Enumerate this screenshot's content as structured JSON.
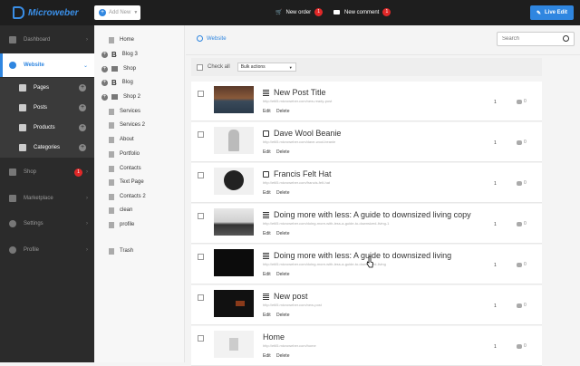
{
  "topbar": {
    "logo_text": "Microweber",
    "add_new": "Add New",
    "new_order": "New order",
    "new_order_count": "1",
    "new_comment": "New comment",
    "new_comment_count": "1",
    "live_edit": "Live Edit"
  },
  "sidebar": {
    "dashboard": "Dashboard",
    "website": "Website",
    "pages": "Pages",
    "posts": "Posts",
    "products": "Products",
    "categories": "Categories",
    "shop": "Shop",
    "shop_badge": "1",
    "marketplace": "Marketplace",
    "settings": "Settings",
    "profile": "Profile"
  },
  "tree": {
    "items": [
      "Home",
      "Blog 3",
      "Shop",
      "Blog",
      "Shop 2",
      "Services",
      "Services 2",
      "About",
      "Portfolio",
      "Contacts",
      "Text Page",
      "Contacts 2",
      "clean",
      "profile"
    ],
    "trash": "Trash"
  },
  "main": {
    "breadcrumb": "Website",
    "search_placeholder": "Search",
    "check_all": "Check all",
    "bulk_actions": "Bulk actions",
    "edit_label": "Edit",
    "delete_label": "Delete"
  },
  "rows": [
    {
      "title": "New Post Title",
      "url": "http://etil5.microweber.com/new-ready-post",
      "count": "1",
      "comments": "0",
      "type": "post"
    },
    {
      "title": "Dave Wool Beanie",
      "url": "http://etil5.microweber.com/dave-wool-beanie",
      "count": "1",
      "comments": "0",
      "type": "product"
    },
    {
      "title": "Francis Felt Hat",
      "url": "http://etil5.microweber.com/francis-felt-hat",
      "count": "1",
      "comments": "0",
      "type": "product"
    },
    {
      "title": "Doing more with less: A guide to downsized living copy",
      "url": "http://etil5.microweber.com/doing-more-with-less-a-guide-to-downsized-living-1",
      "count": "1",
      "comments": "0",
      "type": "post"
    },
    {
      "title": "Doing more with less: A guide to downsized living",
      "url": "http://etil5.microweber.com/doing-more-with-less-a-guide-to-downsized-living",
      "count": "1",
      "comments": "0",
      "type": "post"
    },
    {
      "title": "New post",
      "url": "http://etil5.microweber.com/new-post",
      "count": "1",
      "comments": "0",
      "type": "post"
    },
    {
      "title": "Home",
      "url": "http://etil5.microweber.com/home",
      "count": "1",
      "comments": "0",
      "type": "page"
    }
  ],
  "colors": {
    "accent": "#2f86e0",
    "sidebar_bg": "#2b2b2b",
    "badge": "#e02828"
  }
}
